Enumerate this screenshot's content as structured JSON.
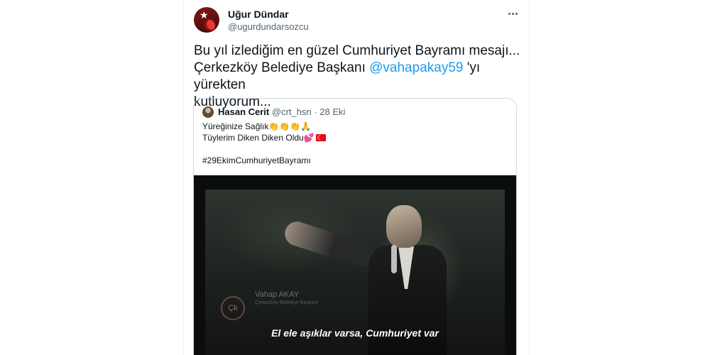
{
  "author": {
    "name": "Uğur Dündar",
    "handle": "@ugurdundarsozcu"
  },
  "tweet": {
    "line1": "Bu yıl izlediğim en güzel Cumhuriyet Bayramı mesajı...",
    "line2_pre": "Çerkezköy Belediye Başkanı ",
    "mention": "@vahapakay59",
    "line2_post": " 'yı yürekten",
    "line3": "kutluyorum..."
  },
  "quote": {
    "name": "Hasan Cerit",
    "handle": "@crt_hsn",
    "separator": "·",
    "date": "28 Eki",
    "line1": "Yüreğinize Sağlık👏👏👏🙏",
    "line2": "Tüylerim Diken Diken Oldu💕",
    "hashtag": "#29EkimCumhuriyetBayramı"
  },
  "video": {
    "watermark_name": "Vahap AKAY",
    "watermark_title": "Çerkezköy Belediye Başkanı",
    "subtitle": "El ele aşıklar varsa, Cumhuriyet var"
  },
  "icons": {
    "more": "more-horizontal-icon",
    "flag": "turkey-flag-icon"
  },
  "colors": {
    "link": "#1d9bf0",
    "text": "#0f1419",
    "secondary": "#536471"
  }
}
